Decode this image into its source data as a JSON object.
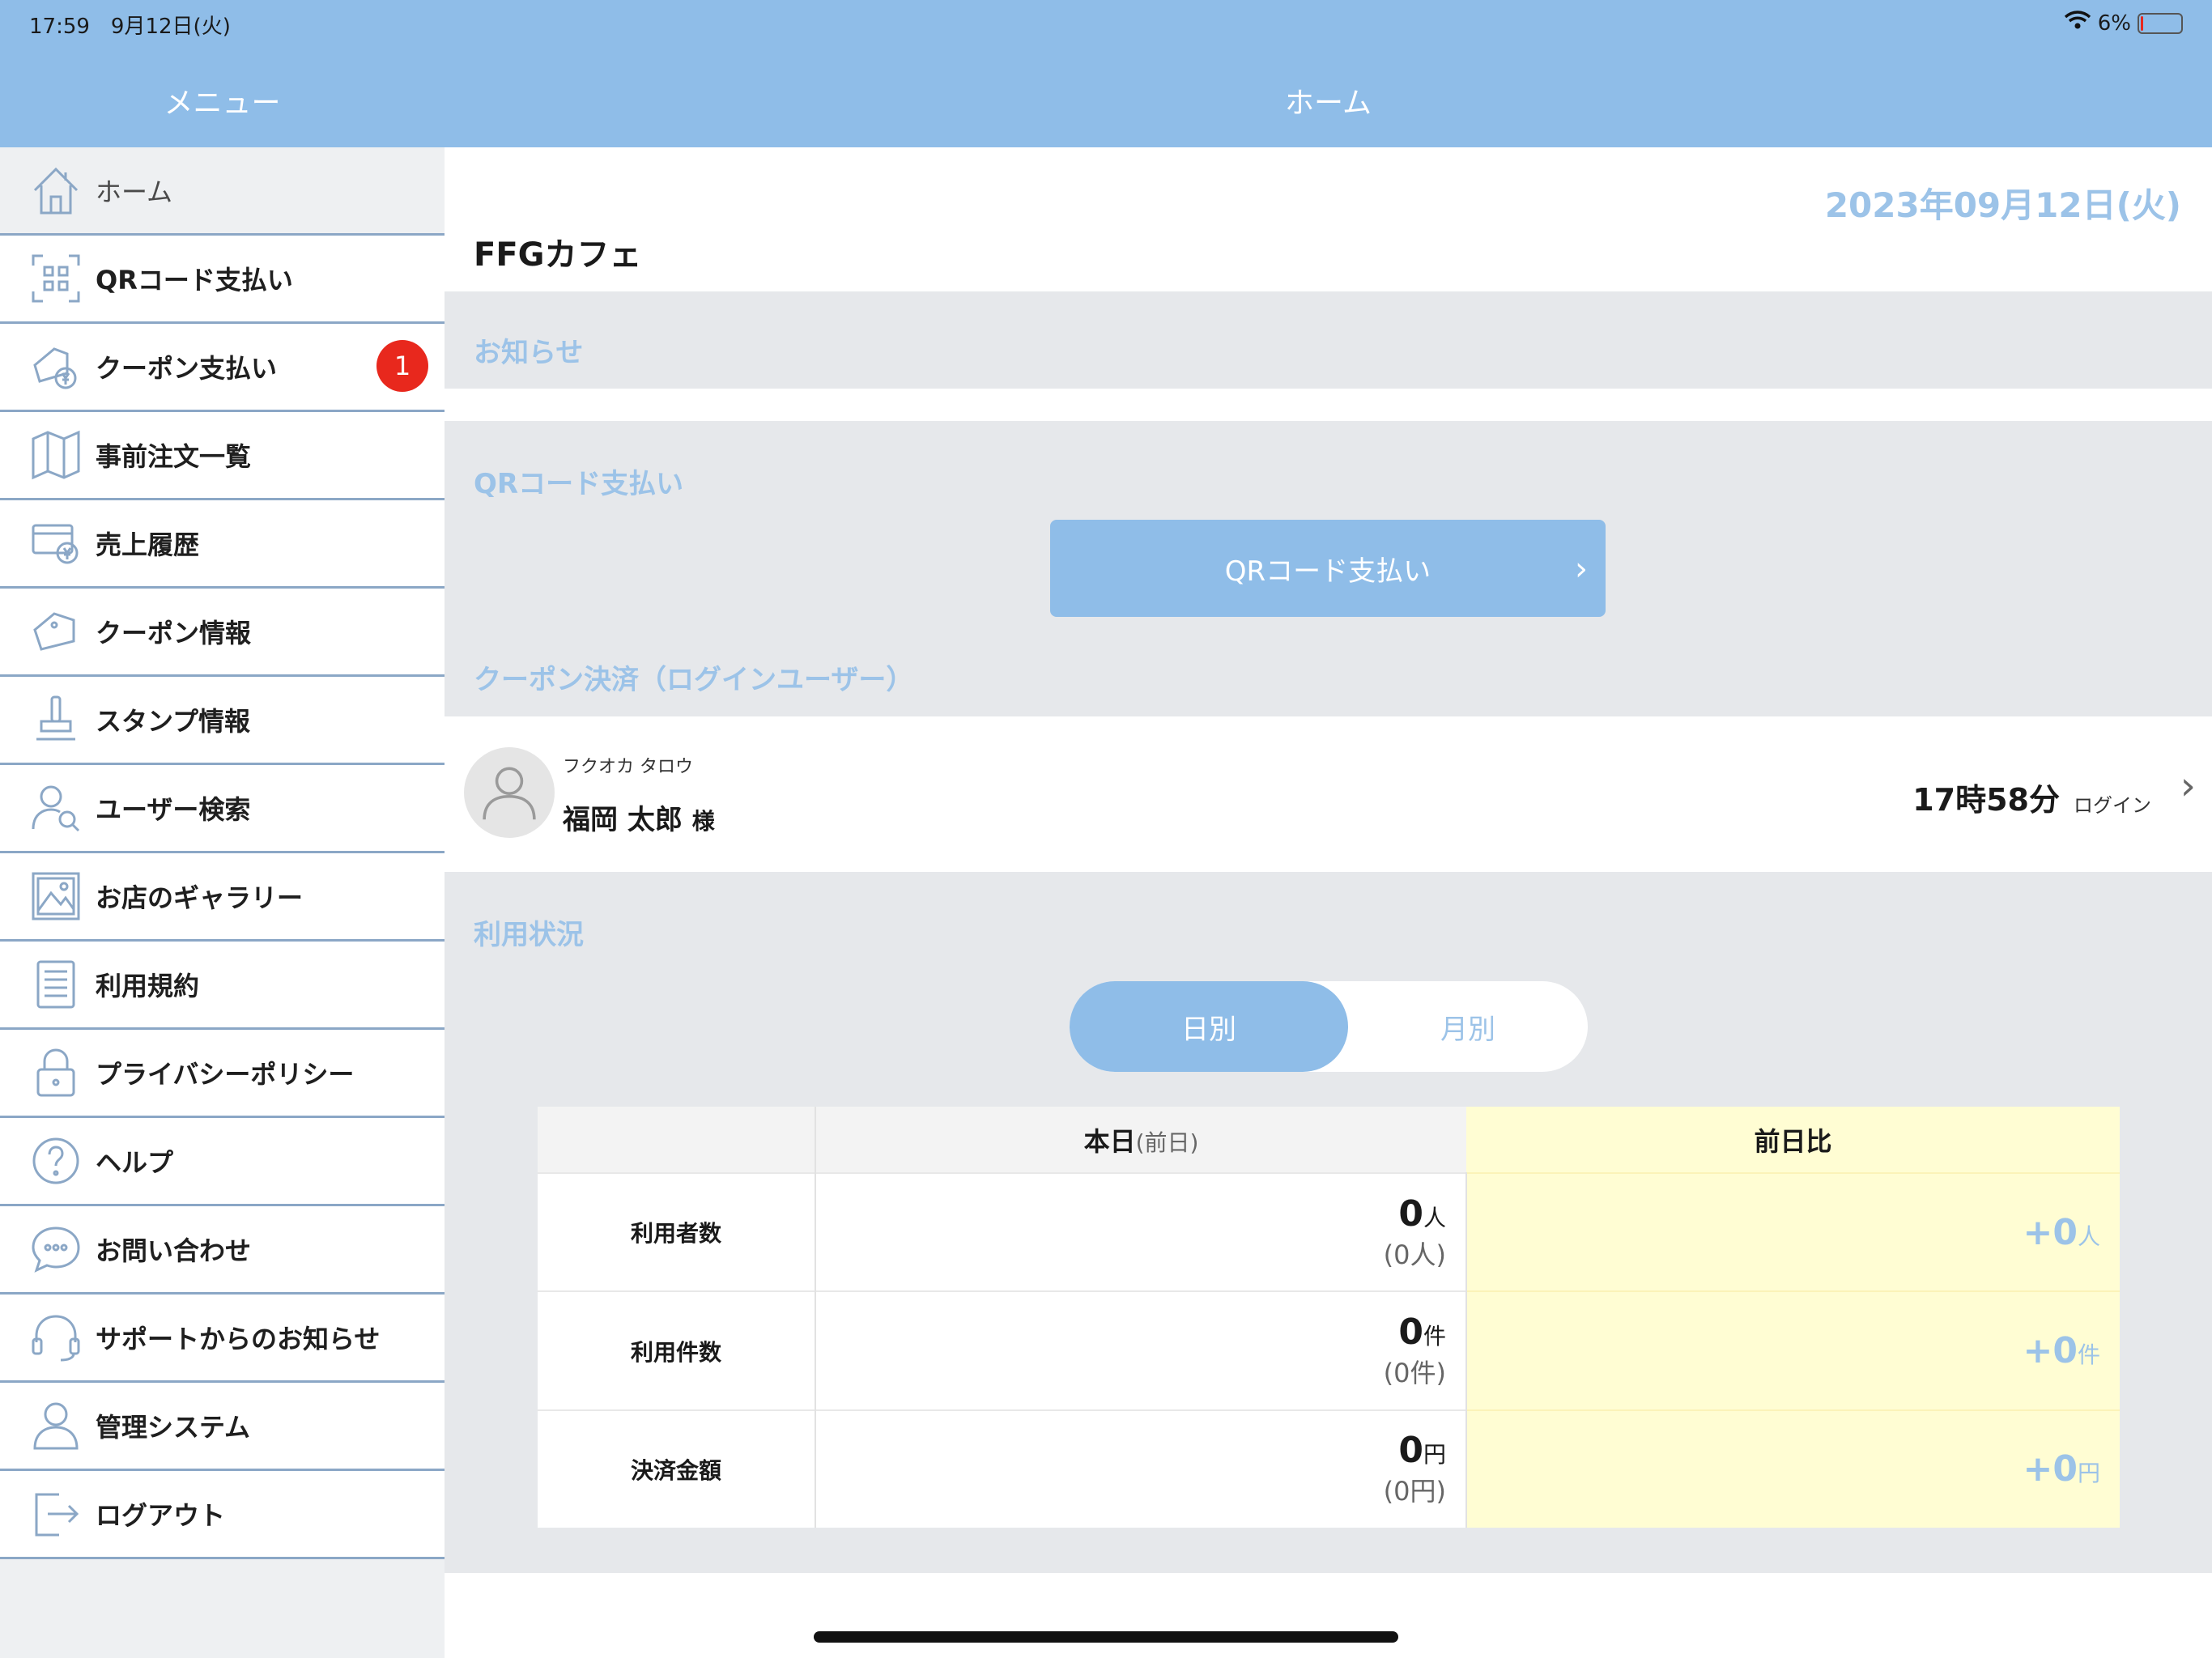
{
  "status": {
    "time": "17:59　9月12日(火)",
    "battery": "6%",
    "battery_level": 0.06
  },
  "sidebar": {
    "title": "メニュー",
    "items": [
      {
        "label": "ホーム",
        "icon": "home-icon"
      },
      {
        "label": "QRコード支払い",
        "icon": "qr-icon"
      },
      {
        "label": "クーポン支払い",
        "icon": "coupon-pay-icon",
        "badge": "1"
      },
      {
        "label": "事前注文一覧",
        "icon": "map-icon"
      },
      {
        "label": "売上履歴",
        "icon": "card-yen-icon"
      },
      {
        "label": "クーポン情報",
        "icon": "coupon-icon"
      },
      {
        "label": "スタンプ情報",
        "icon": "stamp-icon"
      },
      {
        "label": "ユーザー検索",
        "icon": "user-search-icon"
      },
      {
        "label": "お店のギャラリー",
        "icon": "gallery-icon"
      },
      {
        "label": "利用規約",
        "icon": "document-icon"
      },
      {
        "label": "プライバシーポリシー",
        "icon": "lock-icon"
      },
      {
        "label": "ヘルプ",
        "icon": "help-icon"
      },
      {
        "label": "お問い合わせ",
        "icon": "chat-icon"
      },
      {
        "label": "サポートからのお知らせ",
        "icon": "headset-icon"
      },
      {
        "label": "管理システム",
        "icon": "person-icon"
      },
      {
        "label": "ログアウト",
        "icon": "logout-icon"
      }
    ]
  },
  "main": {
    "title": "ホーム",
    "date": "2023年09月12日(火)",
    "shop": "FFGカフェ",
    "notice_label": "お知らせ",
    "qr_section_label": "QRコード支払い",
    "qr_button": "QRコード支払い",
    "coupon_section_label": "クーポン決済（ログインユーザー）",
    "user": {
      "kana": "フクオカ タロウ",
      "name": "福岡 太郎",
      "honorific": "様",
      "time": "17時58分",
      "login": "ログイン"
    },
    "usage_label": "利用状況",
    "segments": {
      "day": "日別",
      "month": "月別"
    },
    "table": {
      "col_today": "本日",
      "col_today_prev": "(前日)",
      "col_compare": "前日比",
      "rows": [
        {
          "label": "利用者数",
          "value": "0",
          "unit": "人",
          "prev": "(0人)",
          "diff": "+0",
          "diff_unit": "人"
        },
        {
          "label": "利用件数",
          "value": "0",
          "unit": "件",
          "prev": "(0件)",
          "diff": "+0",
          "diff_unit": "件"
        },
        {
          "label": "決済金額",
          "value": "0",
          "unit": "円",
          "prev": "(0円)",
          "diff": "+0",
          "diff_unit": "円"
        }
      ]
    }
  }
}
